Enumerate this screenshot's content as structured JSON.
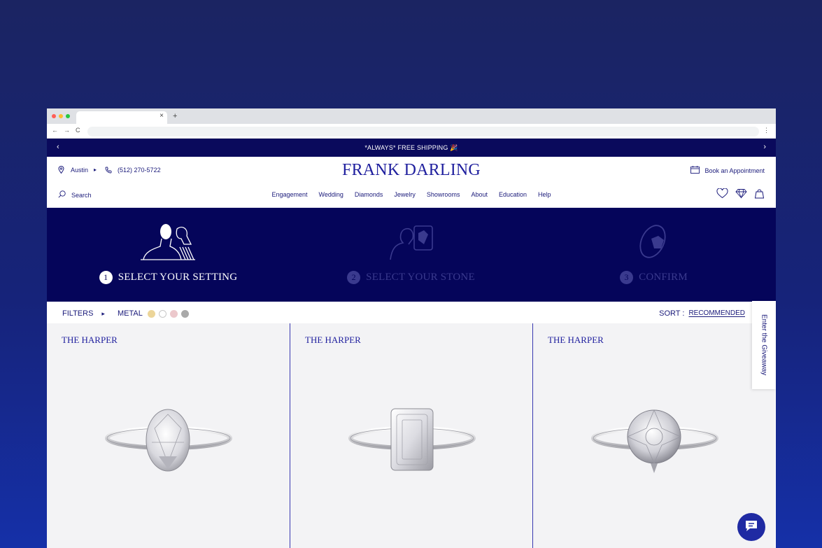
{
  "colors": {
    "background": "#16237a",
    "brand_navy": "#05055a",
    "promo_bar": "#0a0a5c",
    "brand_blue": "#1f1f9e",
    "divider": "#3838b0"
  },
  "browser": {
    "tab_title": "",
    "tab_close": "×",
    "new_tab": "+",
    "back": "←",
    "forward": "→",
    "reload": "C",
    "menu": "⋮"
  },
  "promo": {
    "text": "*ALWAYS* FREE SHIPPING 🎉",
    "prev": "‹",
    "next": "›"
  },
  "header": {
    "location": "Austin",
    "location_caret": "▸",
    "phone": "(512) 270-5722",
    "logo": "FRANK DARLING",
    "book_label": "Book an Appointment",
    "search_label": "Search",
    "nav": [
      "Engagement",
      "Wedding",
      "Diamonds",
      "Jewelry",
      "Showrooms",
      "About",
      "Education",
      "Help"
    ],
    "icons": [
      "heart-icon",
      "diamond-icon",
      "bag-icon"
    ]
  },
  "steps": [
    {
      "number": "1",
      "label": "SELECT YOUR SETTING",
      "state": "active"
    },
    {
      "number": "2",
      "label": "SELECT YOUR STONE",
      "state": "inactive"
    },
    {
      "number": "3",
      "label": "CONFIRM",
      "state": "inactive"
    }
  ],
  "filters": {
    "filters_label": "FILTERS",
    "filters_caret": "▸",
    "metal_label": "METAL",
    "metal_swatches": [
      "#ecd599",
      "#ffffff",
      "#ecc8cc",
      "#a9a9a9"
    ],
    "sort_label": "SORT :",
    "sort_value": "RECOMMENDED"
  },
  "products": [
    {
      "name": "THE HARPER",
      "stone": "oval"
    },
    {
      "name": "THE HARPER",
      "stone": "emerald-cut"
    },
    {
      "name": "THE HARPER",
      "stone": "round"
    }
  ],
  "side_tab": "Enter the Giveaway",
  "chat_icon": "chat-icon"
}
